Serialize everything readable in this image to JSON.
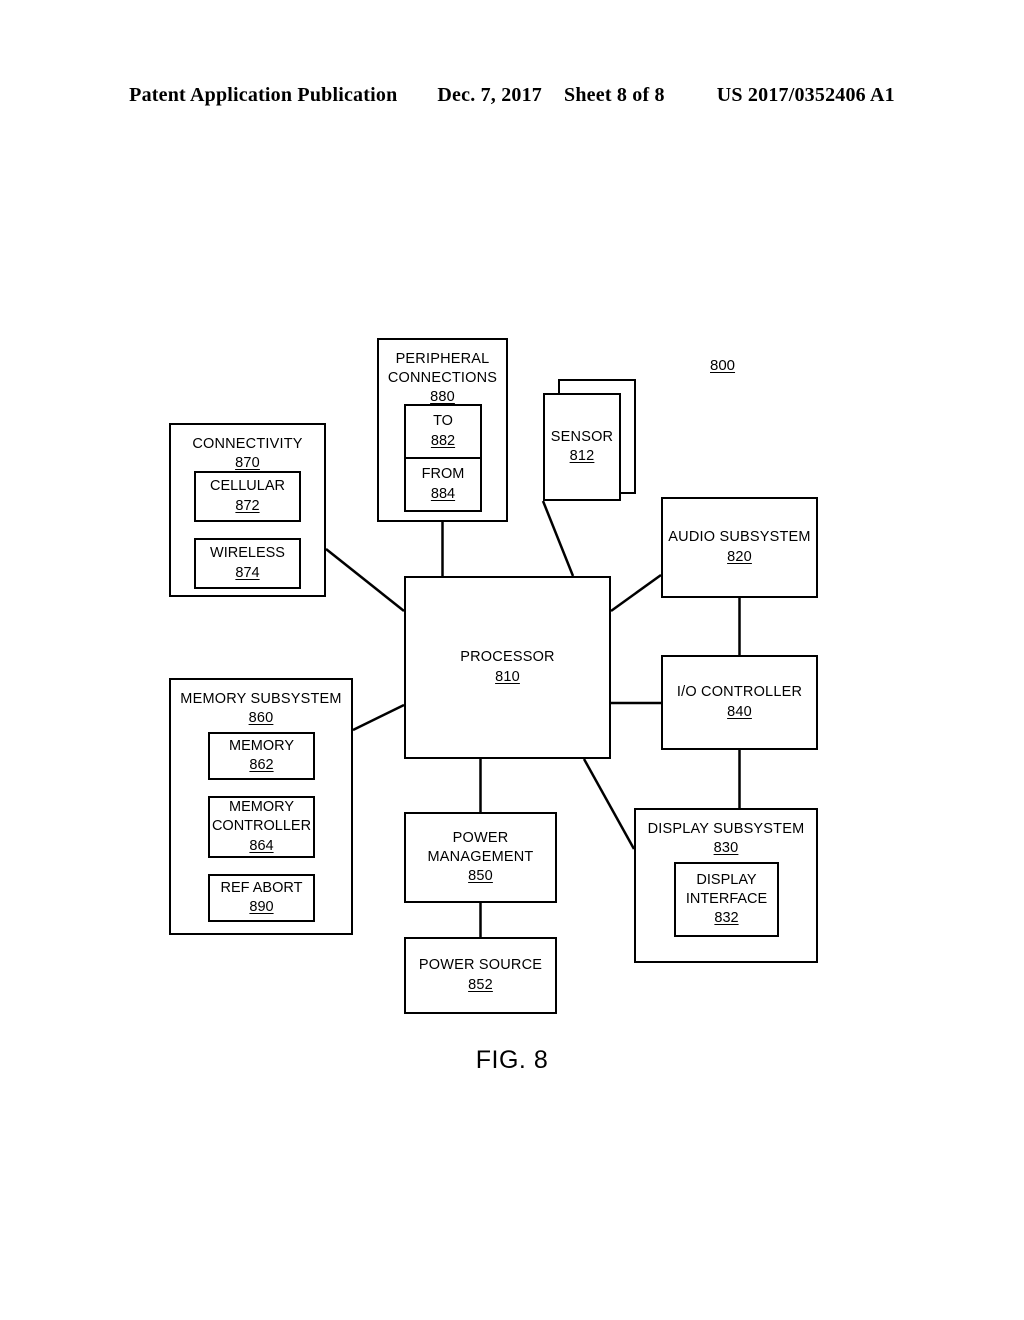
{
  "header": {
    "publication": "Patent Application Publication",
    "date": "Dec. 7, 2017",
    "sheet": "Sheet 8 of 8",
    "number": "US 2017/0352406 A1"
  },
  "figure": {
    "caption": "FIG. 8",
    "system_ref": "800",
    "blocks": {
      "peripheral_connections": {
        "label": "PERIPHERAL\nCONNECTIONS",
        "line1": "PERIPHERAL",
        "line2": "CONNECTIONS",
        "ref": "880"
      },
      "to": {
        "label": "TO",
        "ref": "882"
      },
      "from": {
        "label": "FROM",
        "ref": "884"
      },
      "connectivity": {
        "label": "CONNECTIVITY",
        "ref": "870"
      },
      "cellular": {
        "label": "CELLULAR",
        "ref": "872"
      },
      "wireless": {
        "label": "WIRELESS",
        "ref": "874"
      },
      "sensor": {
        "label": "SENSOR",
        "ref": "812"
      },
      "audio_subsystem": {
        "label": "AUDIO SUBSYSTEM",
        "ref": "820"
      },
      "io_controller": {
        "label": "I/O CONTROLLER",
        "ref": "840"
      },
      "display_subsystem": {
        "label": "DISPLAY SUBSYSTEM",
        "ref": "830"
      },
      "display_interface": {
        "line1": "DISPLAY",
        "line2": "INTERFACE",
        "ref": "832"
      },
      "memory_subsystem": {
        "label": "MEMORY SUBSYSTEM",
        "ref": "860"
      },
      "memory": {
        "label": "MEMORY",
        "ref": "862"
      },
      "memory_controller": {
        "line1": "MEMORY",
        "line2": "CONTROLLER",
        "ref": "864"
      },
      "ref_abort": {
        "label": "REF ABORT",
        "ref": "890"
      },
      "processor": {
        "label": "PROCESSOR",
        "ref": "810"
      },
      "power_management": {
        "label": "POWER MANAGEMENT",
        "ref": "850"
      },
      "power_source": {
        "label": "POWER SOURCE",
        "ref": "852"
      }
    },
    "connections": [
      {
        "from": "peripheral_connections",
        "to": "processor",
        "style": "vertical"
      },
      {
        "from": "connectivity",
        "to": "processor",
        "style": "diagonal"
      },
      {
        "from": "sensor",
        "to": "processor",
        "style": "diagonal"
      },
      {
        "from": "processor",
        "to": "audio_subsystem",
        "style": "diagonal"
      },
      {
        "from": "audio_subsystem",
        "to": "io_controller",
        "style": "vertical"
      },
      {
        "from": "processor",
        "to": "io_controller",
        "style": "horizontal"
      },
      {
        "from": "io_controller",
        "to": "display_subsystem",
        "style": "vertical"
      },
      {
        "from": "processor",
        "to": "display_subsystem",
        "style": "diagonal"
      },
      {
        "from": "memory_subsystem",
        "to": "processor",
        "style": "diagonal"
      },
      {
        "from": "processor",
        "to": "power_management",
        "style": "vertical"
      },
      {
        "from": "power_management",
        "to": "power_source",
        "style": "vertical"
      }
    ],
    "colors": {
      "ink": "#000000",
      "paper": "#ffffff"
    }
  }
}
